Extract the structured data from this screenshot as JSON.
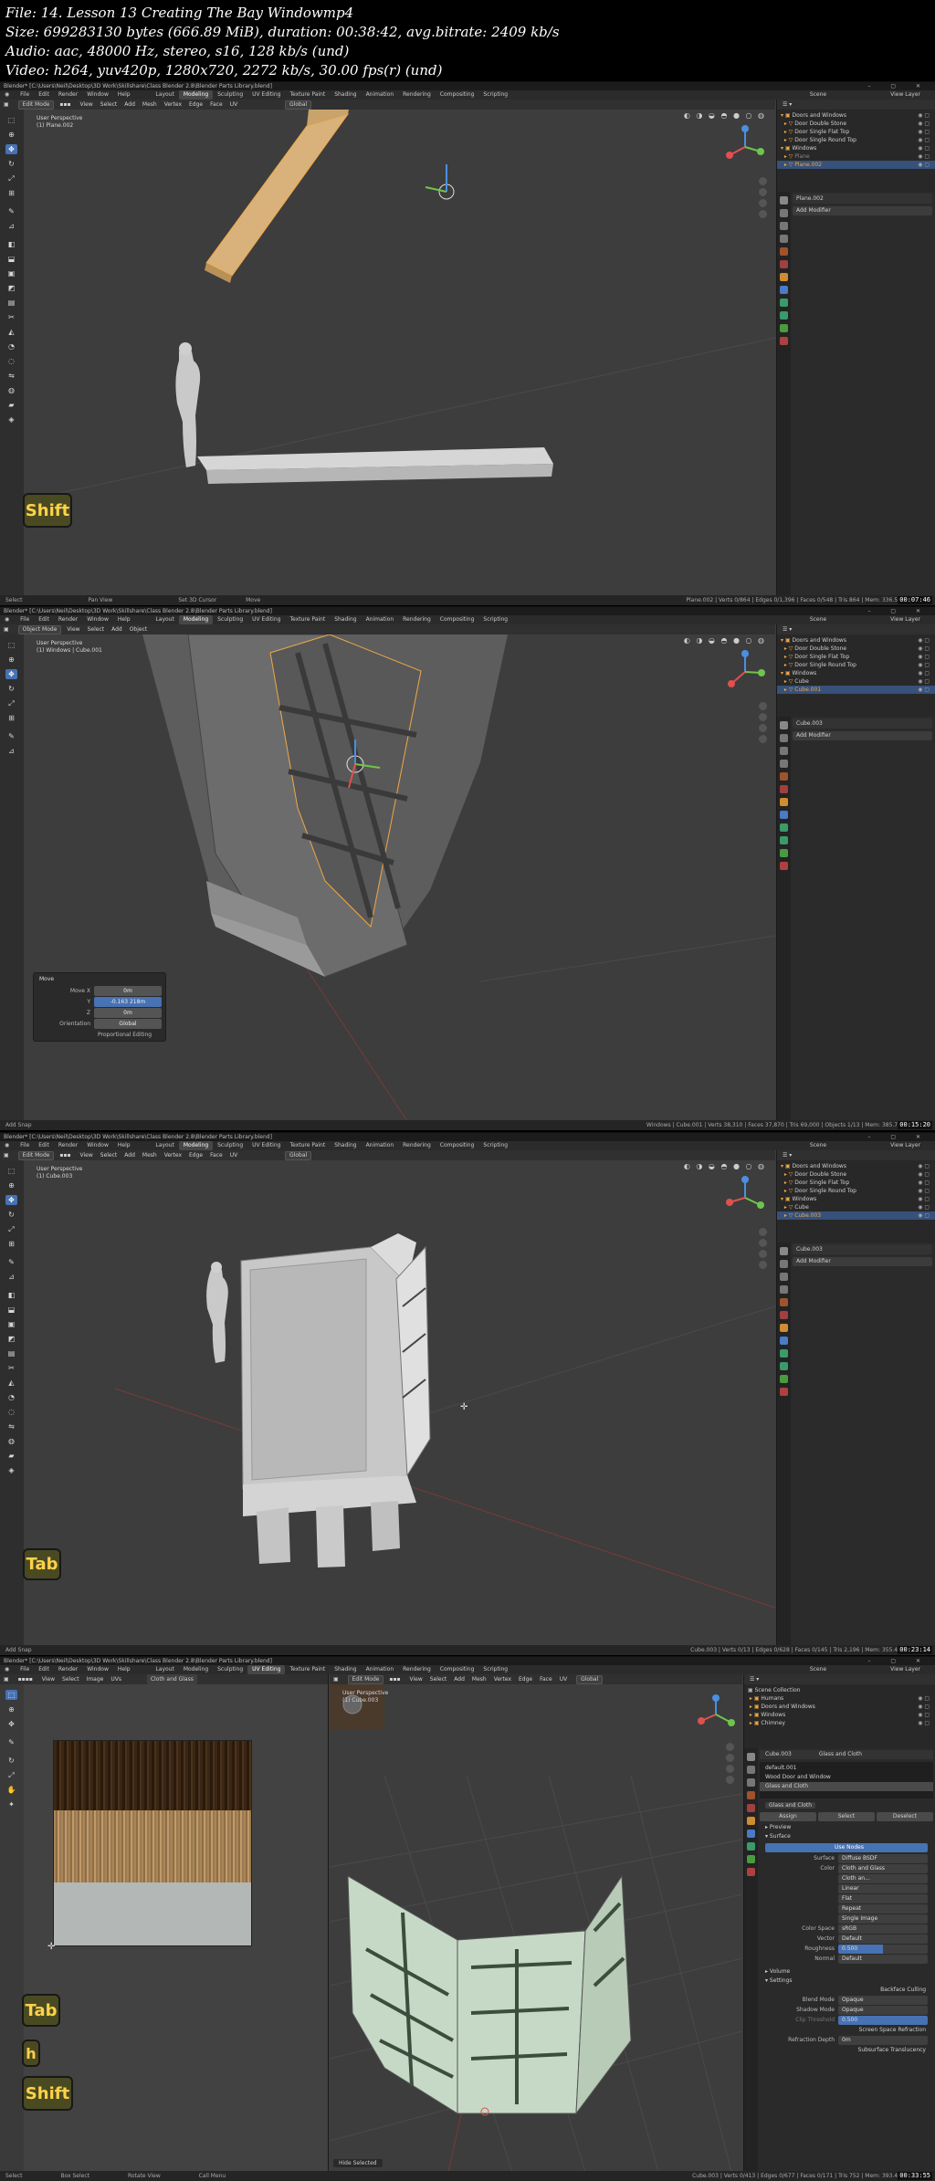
{
  "file_info": {
    "line1": "File: 14. Lesson 13 Creating The Bay Windowmp4",
    "line2": "Size: 699283130 bytes (666.89 MiB), duration: 00:38:42, avg.bitrate: 2409 kb/s",
    "line3": "Audio: aac, 48000 Hz, stereo, s16, 128 kb/s (und)",
    "line4": "Video: h264, yuv420p, 1280x720, 2272 kb/s, 30.00 fps(r) (und)"
  },
  "blender": {
    "title": "Blender* [C:\\Users\\Neil\\Desktop\\3D Work\\Skillshare\\Class Blender 2.8\\Blender Parts Library.blend]",
    "menus": [
      "File",
      "Edit",
      "Render",
      "Window",
      "Help"
    ],
    "workspaces": [
      "Layout",
      "Modeling",
      "Sculpting",
      "UV Editing",
      "Texture Paint",
      "Shading",
      "Animation",
      "Rendering",
      "Compositing",
      "Scripting"
    ],
    "active_workspace": "Modeling",
    "scene": "Scene",
    "view_layer": "View Layer",
    "header_menus": [
      "View",
      "Select",
      "Add",
      "Mesh",
      "Vertex",
      "Edge",
      "Face",
      "UV"
    ],
    "object_menus": [
      "View",
      "Select",
      "Add",
      "Object"
    ],
    "orientation": "Global",
    "add_modifier": "Add Modifier",
    "colors": {
      "active_blue": "#4772b3",
      "selected_orange": "#f0a846",
      "key_yellow": "#ffd24a"
    }
  },
  "frames": [
    {
      "mode": "Edit Mode",
      "view_label": "User Perspective",
      "object_label": "(1) Plane.002",
      "outliner": [
        {
          "label": "Doors and Windows"
        },
        {
          "label": "Door Double Stone"
        },
        {
          "label": "Door Single Flat Top"
        },
        {
          "label": "Door Single Round Top"
        },
        {
          "label": "Windows"
        },
        {
          "label": "Plane"
        },
        {
          "label": "Plane.002"
        }
      ],
      "props_object": "Plane.002",
      "status_left": "Select",
      "status_mid": "Pan View",
      "status_mid2": "Set 3D Cursor",
      "status_mid3": "Move",
      "status_right": "Plane.002 | Verts 0/864 | Edges 0/1,396 | Faces 0/548 | Tris 864 | Mem: 336.5 MiB",
      "timestamp": "00:07:46",
      "key": "Shift"
    },
    {
      "mode": "Object Mode",
      "view_label": "User Perspective",
      "object_label": "(1) Windows | Cube.001",
      "outliner": [
        {
          "label": "Doors and Windows"
        },
        {
          "label": "Door Double Stone"
        },
        {
          "label": "Door Single Flat Top"
        },
        {
          "label": "Door Single Round Top"
        },
        {
          "label": "Windows"
        },
        {
          "label": "Cube"
        },
        {
          "label": "Cube.001"
        }
      ],
      "props_object": "Cube.003",
      "redo": {
        "title": "Move",
        "move_x_label": "Move X",
        "move_x": "0m",
        "y_label": "Y",
        "y": "-0.163 218m",
        "z_label": "Z",
        "z": "0m",
        "orientation_label": "Orientation",
        "orientation": "Global",
        "proportional": "Proportional Editing"
      },
      "status_left": "Add Snap",
      "status_right": "Windows | Cube.001 | Verts 38,310 | Faces 37,870 | Tris 69,000 | Objects 1/13 | Mem: 385.7 MiB",
      "timestamp": "00:15:20"
    },
    {
      "mode": "Edit Mode",
      "view_label": "User Perspective",
      "object_label": "(1) Cube.003",
      "outliner": [
        {
          "label": "Doors and Windows"
        },
        {
          "label": "Door Double Stone"
        },
        {
          "label": "Door Single Flat Top"
        },
        {
          "label": "Door Single Round Top"
        },
        {
          "label": "Windows"
        },
        {
          "label": "Cube"
        },
        {
          "label": "Cube.003"
        }
      ],
      "props_object": "Cube.003",
      "status_left": "Add Snap",
      "status_right": "Cube.003 | Verts 0/13 | Edges 0/628 | Faces 0/145 | Tris 2,196 | Mem: 355.4 MiB",
      "timestamp": "00:23:14",
      "key": "Tab"
    },
    {
      "mode": "Edit Mode",
      "uv_menus": [
        "View",
        "Select",
        "Image",
        "UVs"
      ],
      "image_name": "Cloth and Glass",
      "view_label": "User Perspective",
      "object_label": "(1) Cube.003",
      "outliner": [
        {
          "label": "Scene Collection"
        },
        {
          "label": "Humans"
        },
        {
          "label": "Doors and Windows"
        },
        {
          "label": "Windows"
        },
        {
          "label": "Chimney"
        }
      ],
      "material": {
        "object": "Cube.003",
        "material_name": "Glass and Cloth",
        "slots": [
          "default.001",
          "Wood Door and Window",
          "Glass and Cloth"
        ],
        "slot_field": "Glass and Cloth",
        "buttons": [
          "Assign",
          "Select",
          "Deselect"
        ],
        "preview": "Preview",
        "surface": "Surface",
        "use_nodes": "Use Nodes",
        "surface_shader": "Diffuse BSDF",
        "color": "Cloth and Glass",
        "rows": [
          {
            "k": "Surface",
            "v": "Diffuse BSDF"
          },
          {
            "k": "Color",
            "v": "Cloth and Glass"
          },
          {
            "k": "",
            "v": "Cloth an..."
          },
          {
            "k": "",
            "v": "Linear"
          },
          {
            "k": "",
            "v": "Flat"
          },
          {
            "k": "",
            "v": "Repeat"
          },
          {
            "k": "",
            "v": "Single Image"
          },
          {
            "k": "Color Space",
            "v": "sRGB"
          },
          {
            "k": "Vector",
            "v": "Default"
          },
          {
            "k": "Roughness",
            "v": "0.500"
          },
          {
            "k": "Normal",
            "v": "Default"
          }
        ],
        "volume": "Volume",
        "settings": "Settings",
        "backface": "Backface Culling",
        "blend_mode": {
          "k": "Blend Mode",
          "v": "Opaque"
        },
        "shadow_mode": {
          "k": "Shadow Mode",
          "v": "Opaque"
        },
        "clip": {
          "k": "Clip Threshold",
          "v": "0.500"
        },
        "ssr": "Screen Space Refraction",
        "refraction": {
          "k": "Refraction Depth",
          "v": "0m"
        },
        "sss": "Subsurface Translucency"
      },
      "status_left": "Select",
      "status_mid": "Box Select",
      "status_mid2": "Rotate View",
      "status_mid3": "Call Menu",
      "hide_selected": "Hide Selected",
      "status_right": "Cube.003 | Verts 0/413 | Edges 0/677 | Faces 0/171 | Tris 752 | Mem: 393.4 MiB",
      "timestamp": "00:33:55",
      "keys": [
        "Tab",
        "h",
        "Shift"
      ]
    }
  ]
}
